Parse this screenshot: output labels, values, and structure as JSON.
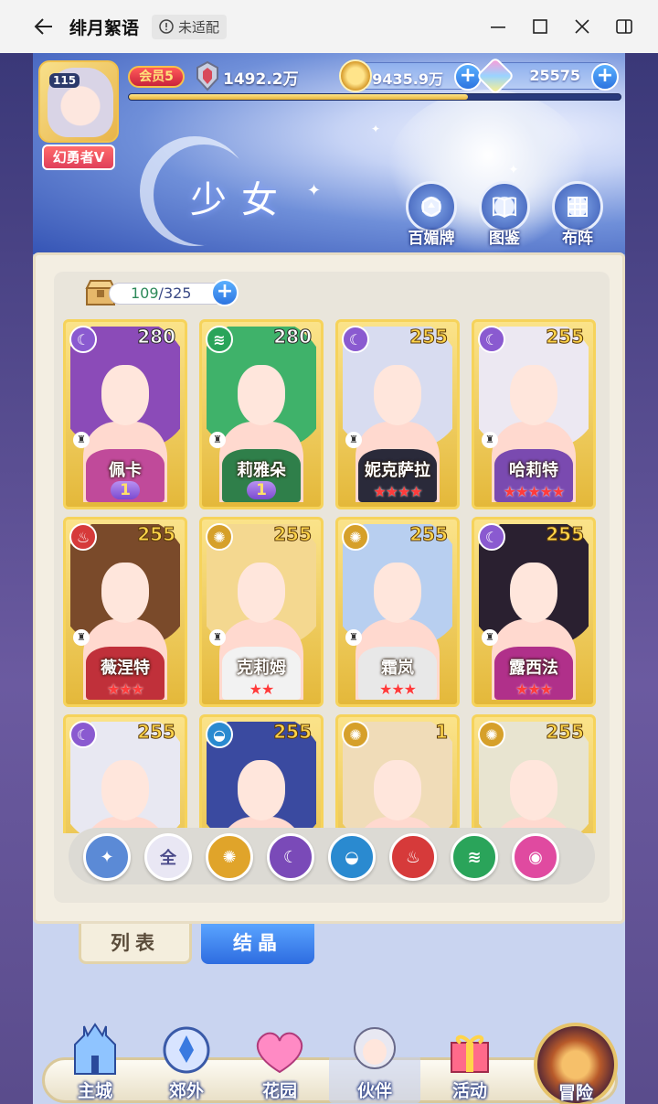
{
  "window": {
    "title": "绯月絮语",
    "badge": "未适配"
  },
  "hud": {
    "level": "115",
    "title_tag": "幻勇者V",
    "vip": "会员5",
    "power": "1492.2万",
    "gold": "9435.9万",
    "gems": "25575",
    "xp_fraction": 0.69
  },
  "banner": {
    "title": "少女",
    "buttons": [
      {
        "label": "百媚牌",
        "icon": "card-deck-icon"
      },
      {
        "label": "图鉴",
        "icon": "book-icon"
      },
      {
        "label": "布阵",
        "icon": "grid-formation-icon"
      }
    ]
  },
  "roster": {
    "count_current": "109",
    "count_max": "/325"
  },
  "cards": [
    {
      "name": "佩卡",
      "level": "280",
      "element": "moon",
      "rank_type": "wing",
      "rank": "1",
      "hair": "#8b4bb8",
      "outfit": "#c04a9a"
    },
    {
      "name": "莉雅朵",
      "level": "280",
      "element": "wind",
      "rank_type": "wing",
      "rank": "1",
      "hair": "#3fb26a",
      "outfit": "#2f7f4a"
    },
    {
      "name": "妮克萨拉",
      "level": "255",
      "element": "moon",
      "rank_type": "stars",
      "stars": 4,
      "hair": "#d8dcf0",
      "outfit": "#2a2a3a"
    },
    {
      "name": "哈莉特",
      "level": "255",
      "element": "moon",
      "rank_type": "stars",
      "stars": 5,
      "hair": "#ece8f2",
      "outfit": "#7a4ab0"
    },
    {
      "name": "薇涅特",
      "level": "255",
      "element": "fire",
      "rank_type": "stars",
      "stars": 3,
      "hair": "#7a4a2a",
      "outfit": "#c0303a"
    },
    {
      "name": "克莉姆",
      "level": "255",
      "element": "sun",
      "rank_type": "stars",
      "stars": 2,
      "hair": "#f4d890",
      "outfit": "#f2f2f2"
    },
    {
      "name": "霜岚",
      "level": "255",
      "element": "sun",
      "rank_type": "stars",
      "stars": 3,
      "hair": "#b8cff0",
      "outfit": "#e8e8e8"
    },
    {
      "name": "露西法",
      "level": "255",
      "element": "moon",
      "rank_type": "stars",
      "stars": 3,
      "hair": "#2a2030",
      "outfit": "#b0308a"
    },
    {
      "name": "",
      "level": "255",
      "element": "moon",
      "rank_type": "none",
      "hair": "#e8e8f2",
      "outfit": "#3a2a2a"
    },
    {
      "name": "",
      "level": "255",
      "element": "water",
      "rank_type": "none",
      "hair": "#3a4aa0",
      "outfit": "#2a3a7a"
    },
    {
      "name": "",
      "level": "1",
      "element": "sun",
      "rank_type": "none",
      "hair": "#f0dcb8",
      "outfit": "#8a6a4a"
    },
    {
      "name": "",
      "level": "255",
      "element": "sun",
      "rank_type": "none",
      "hair": "#e8e4d0",
      "outfit": "#3a8a6a"
    }
  ],
  "filters": [
    {
      "name": "star-filter",
      "label": "",
      "color": "#5b8ad6"
    },
    {
      "name": "all-filter",
      "label": "全",
      "color": "#e9e7f4"
    },
    {
      "name": "sun-filter",
      "label": "",
      "color": "#e0a42a"
    },
    {
      "name": "moon-filter",
      "label": "",
      "color": "#7a4ab8"
    },
    {
      "name": "water-filter",
      "label": "",
      "color": "#2a8ad0"
    },
    {
      "name": "fire-filter",
      "label": "",
      "color": "#d63a3a"
    },
    {
      "name": "wind-filter",
      "label": "",
      "color": "#2aa45a"
    },
    {
      "name": "arcane-filter",
      "label": "",
      "color": "#e04aa0"
    }
  ],
  "tabs": {
    "list": "列表",
    "crystal": "结晶"
  },
  "nav": [
    {
      "label": "主城",
      "icon": "castle-icon"
    },
    {
      "label": "郊外",
      "icon": "outskirts-icon"
    },
    {
      "label": "花园",
      "icon": "garden-heart-icon"
    },
    {
      "label": "伙伴",
      "icon": "partner-icon"
    },
    {
      "label": "活动",
      "icon": "gift-box-icon"
    },
    {
      "label": "冒险",
      "icon": "adventure-compass-icon"
    }
  ]
}
